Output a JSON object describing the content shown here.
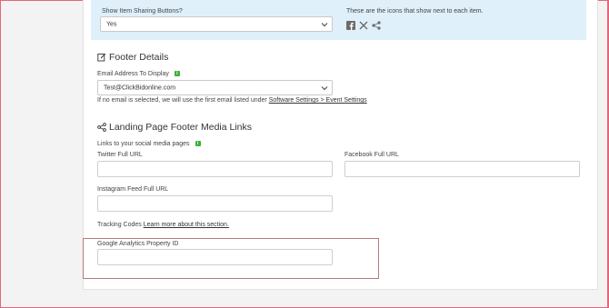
{
  "item_sharing": {
    "label": "Show Item Sharing Buttons?",
    "selected": "Yes",
    "icons_note": "These are the icons that show next to each item.",
    "icons": [
      "facebook-icon",
      "x-icon",
      "share-icon"
    ]
  },
  "footer_details": {
    "title": "Footer Details",
    "email_label": "Email Address To Display",
    "email_selected": "Test@ClickBidonline.com",
    "note_prefix": "If no email is selected, we will use the first email listed under ",
    "note_link": "Software Settings > Event Settings"
  },
  "media_links": {
    "title": "Landing Page Footer Media Links",
    "intro": "Links to your social media pages",
    "twitter_label": "Twitter Full URL",
    "facebook_label": "Facebook Full URL",
    "instagram_label": "Instagram Feed Full URL",
    "tracking_prefix": "Tracking Codes ",
    "tracking_link": "Learn more about this section.",
    "ga_label": "Google Analytics Property ID"
  },
  "colors": {
    "panel_bg": "#dff0fb",
    "badge": "#3eae3a",
    "frame": "#e3677a"
  }
}
